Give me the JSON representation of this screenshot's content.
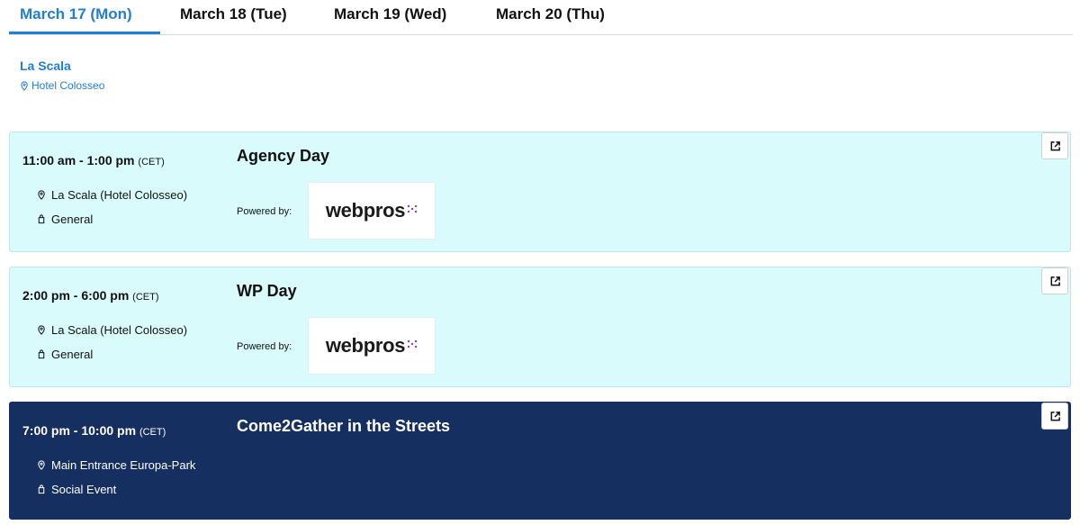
{
  "tabs": [
    {
      "label": "March 17 (Mon)",
      "active": true
    },
    {
      "label": "March 18 (Tue)",
      "active": false
    },
    {
      "label": "March 19 (Wed)",
      "active": false
    },
    {
      "label": "March 20 (Thu)",
      "active": false
    }
  ],
  "venue": {
    "name": "La Scala",
    "hotel": "Hotel Colosseo"
  },
  "sessions": [
    {
      "time": "11:00 am - 1:00 pm",
      "tz": "(CET)",
      "title": "Agency Day",
      "location": "La Scala (Hotel Colosseo)",
      "track": "General",
      "powered_by": "Powered by:",
      "sponsor": "webpros",
      "theme": "light"
    },
    {
      "time": "2:00 pm - 6:00 pm",
      "tz": "(CET)",
      "title": "WP Day",
      "location": "La Scala (Hotel Colosseo)",
      "track": "General",
      "powered_by": "Powered by:",
      "sponsor": "webpros",
      "theme": "light"
    },
    {
      "time": "7:00 pm - 10:00 pm",
      "tz": "(CET)",
      "title": "Come2Gather in the Streets",
      "location": "Main Entrance Europa-Park",
      "track": "Social Event",
      "theme": "dark"
    }
  ],
  "colors": {
    "accent": "#1f7fd6",
    "card_light": "#d9fbfc",
    "card_dark": "#142f60",
    "sponsor_mark": "#8a3fd1"
  },
  "icons": {
    "external": "external-link-icon",
    "location": "map-pin-icon",
    "track": "tag-icon"
  }
}
